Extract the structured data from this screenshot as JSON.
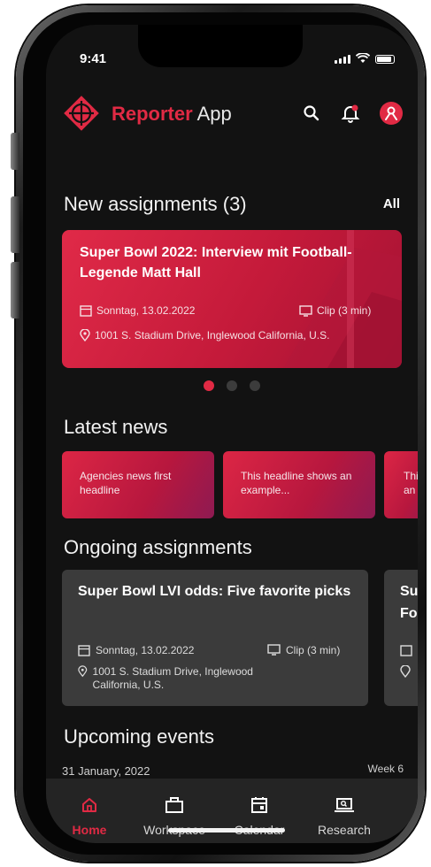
{
  "status": {
    "time": "9:41"
  },
  "header": {
    "brand_primary": "Reporter",
    "brand_secondary": "App"
  },
  "new_assignments": {
    "title": "New assignments (3)",
    "all_label": "All",
    "card": {
      "title": "Super Bowl 2022: Interview mit Football-Legende Matt Hall",
      "date": "Sonntag, 13.02.2022",
      "media": "Clip (3 min)",
      "location": "1001 S. Stadium Drive, Inglewood California, U.S."
    },
    "page_count": 3,
    "active_page": 1
  },
  "latest_news": {
    "title": "Latest news",
    "items": [
      {
        "text": "Agencies news first headline"
      },
      {
        "text": "This headline shows an example..."
      },
      {
        "text": "This an"
      }
    ]
  },
  "ongoing": {
    "title": "Ongoing assignments",
    "cards": [
      {
        "title": "Super Bowl LVI odds: Five favorite picks",
        "date": "Sonntag, 13.02.2022",
        "media": "Clip (3 min)",
        "location": "1001 S. Stadium Drive, Inglewood California, U.S."
      },
      {
        "title": "Su Fo"
      }
    ]
  },
  "upcoming": {
    "title": "Upcoming events",
    "date": "31 January, 2022",
    "week": "Week 6"
  },
  "nav": {
    "items": [
      {
        "label": "Home"
      },
      {
        "label": "Workspace"
      },
      {
        "label": "Calendar"
      },
      {
        "label": "Research"
      }
    ],
    "active": "Home"
  },
  "colors": {
    "accent": "#e12a44",
    "background": "#121212",
    "card": "#3b3b3b",
    "nav": "#242424"
  }
}
